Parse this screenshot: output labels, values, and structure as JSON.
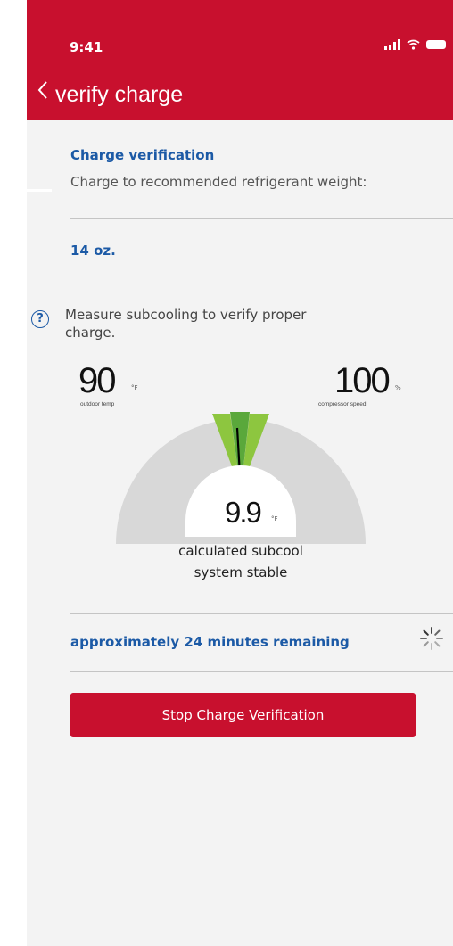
{
  "status_bar": {
    "time": "9:41"
  },
  "header": {
    "back_icon": "chevron-left-icon",
    "title": "verify charge"
  },
  "verification": {
    "title": "Charge verification",
    "description": "Charge to recommended refrigerant weight:",
    "amount": "14 oz."
  },
  "measure": {
    "help_icon": "question-circle-icon",
    "text": "Measure subcooling to verify proper charge."
  },
  "outdoor": {
    "value": "90",
    "unit": "°F",
    "label": "outdoor temp"
  },
  "compressor": {
    "value": "100",
    "unit": "%",
    "label": "compressor speed"
  },
  "gauge": {
    "value": "9.9",
    "unit": "°F",
    "caption_line1": "calculated subcool",
    "caption_line2": "system stable",
    "colors": {
      "track": "#d8d8d8",
      "zone_light": "#8dc63f",
      "zone_dark": "#5aa83b",
      "needle": "#000000"
    }
  },
  "progress": {
    "text": "approximately 24 minutes remaining",
    "spinner_icon": "spinner-icon"
  },
  "action": {
    "stop_label": "Stop Charge Verification"
  },
  "theme": {
    "brand_red": "#c8102e",
    "link_blue": "#1c5aa6"
  }
}
